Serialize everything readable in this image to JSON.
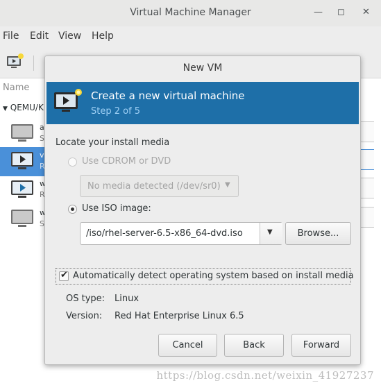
{
  "main_window": {
    "title": "Virtual Machine Manager",
    "controls": {
      "minimize": "—",
      "maximize": "◻",
      "close": "✕"
    },
    "menus": [
      "File",
      "Edit",
      "View",
      "Help"
    ],
    "list_header": "Name",
    "connection": "QEMU/K",
    "vms": [
      {
        "name": "a",
        "status": "S",
        "icon": "monitor-off-icon"
      },
      {
        "name": "v",
        "status": "R",
        "icon": "monitor-running-icon"
      },
      {
        "name": "w",
        "status": "R",
        "icon": "monitor-running-icon"
      },
      {
        "name": "w",
        "status": "S",
        "icon": "monitor-off-icon"
      }
    ]
  },
  "dialog": {
    "title": "New VM",
    "banner": {
      "heading": "Create a new virtual machine",
      "step": "Step 2 of 5"
    },
    "locate_label": "Locate your install media",
    "cdrom_option": "Use CDROM or DVD",
    "media_select": "No media detected (/dev/sr0)",
    "iso_option": "Use ISO image:",
    "iso_path": "/iso/rhel-server-6.5-x86_64-dvd.iso",
    "browse_label": "Browse...",
    "auto_detect_label": "Automatically detect operating system based on install media",
    "auto_detect_checked": true,
    "os_type_label": "OS type:",
    "os_type_value": "Linux",
    "version_label": "Version:",
    "version_value": "Red Hat Enterprise Linux 6.5",
    "cancel_label": "Cancel",
    "back_label": "Back",
    "forward_label": "Forward"
  },
  "watermark": "https://blog.csdn.net/weixin_41927237",
  "colors": {
    "banner": "#1e6fa8",
    "selection": "#4a90d9"
  }
}
